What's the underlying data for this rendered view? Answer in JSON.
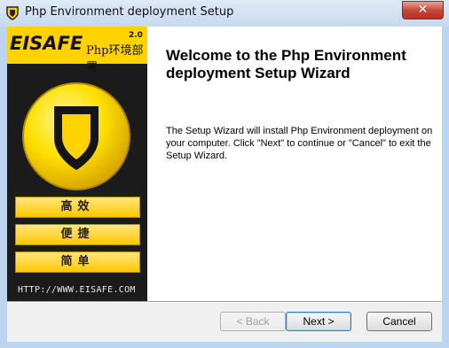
{
  "window": {
    "title": "Php Environment deployment Setup",
    "close_glyph": "✕"
  },
  "sidebar": {
    "brand": "EISAFE",
    "brand_sub": "Php环境部署",
    "version": "2.0",
    "buttons": [
      "高效",
      "便捷",
      "简单"
    ],
    "site_url": "HTTP://WWW.EISAFE.COM",
    "icon": "shield-icon"
  },
  "content": {
    "heading": "Welcome to the Php Environment deployment Setup Wizard",
    "body": "The Setup Wizard will install Php Environment deployment on your computer.  Click \"Next\" to continue or \"Cancel\" to exit the Setup Wizard."
  },
  "buttons": {
    "back": "< Back",
    "next": "Next >",
    "cancel": "Cancel"
  },
  "colors": {
    "brand_yellow": "#ffd200",
    "sidebar_dark": "#1b1b1b"
  }
}
